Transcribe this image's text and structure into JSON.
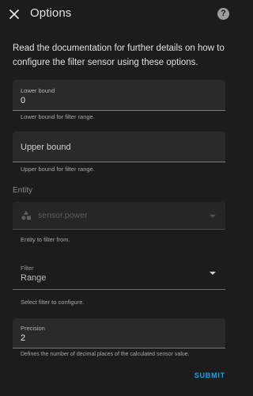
{
  "header": {
    "title": "Options",
    "close_icon": "close-icon",
    "help_icon": "help-icon",
    "help_glyph": "?"
  },
  "intro": "Read the documentation for further details on how to configure the filter sensor using these options.",
  "lower_bound": {
    "label": "Lower bound",
    "value": "0",
    "helper": "Lower bound for filter range."
  },
  "upper_bound": {
    "placeholder": "Upper bound",
    "helper": "Upper bound for filter range."
  },
  "entity": {
    "section_label": "Entity",
    "value": "sensor.power",
    "icon": "shapes-icon",
    "helper": "Entity to filter from."
  },
  "filter": {
    "label": "Filter",
    "value": "Range",
    "helper": "Select filter to configure."
  },
  "precision": {
    "label": "Precision",
    "value": "2",
    "helper": "Defines the number of decimal places of the calculated sensor value."
  },
  "footer": {
    "submit_label": "SUBMIT"
  },
  "colors": {
    "background": "#1c1c1c",
    "field": "#2a2a2a",
    "accent": "#03a9f4"
  }
}
